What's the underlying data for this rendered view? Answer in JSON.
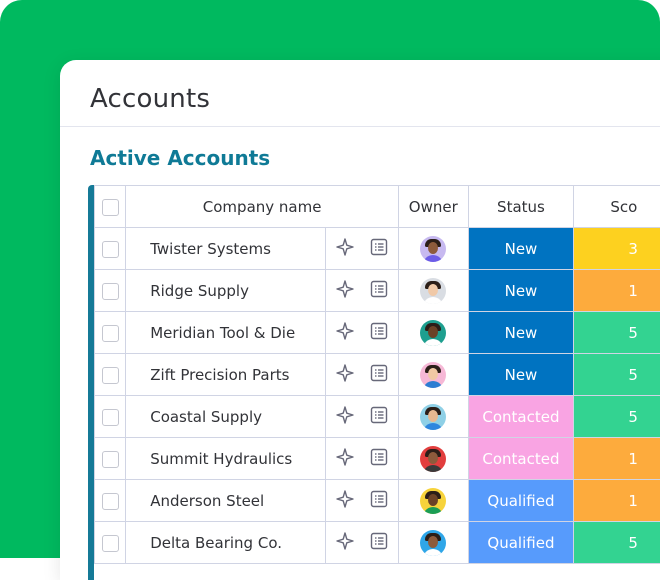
{
  "page": {
    "title": "Accounts"
  },
  "group": {
    "title": "Active Accounts",
    "color": "#157a97"
  },
  "columns": {
    "company": "Company name",
    "owner": "Owner",
    "status": "Status",
    "score": "Sco"
  },
  "rows": [
    {
      "company": "Twister Systems",
      "status": "New",
      "status_color": "#0073c1",
      "score": "3",
      "score_color": "#fdd11f",
      "avatar_bg": "#c7b9f0",
      "avatar_skin": "#8d5b3c",
      "avatar_shirt": "#6c5ce7"
    },
    {
      "company": "Ridge Supply",
      "status": "New",
      "status_color": "#0073c1",
      "score": "1",
      "score_color": "#fdab3d",
      "avatar_bg": "#d9dde3",
      "avatar_skin": "#f0c9a8",
      "avatar_shirt": "#ffffff"
    },
    {
      "company": "Meridian Tool & Die",
      "status": "New",
      "status_color": "#0073c1",
      "score": "5",
      "score_color": "#33d391",
      "avatar_bg": "#1e9f8f",
      "avatar_skin": "#6b4226",
      "avatar_shirt": "#ffffff"
    },
    {
      "company": "Zift Precision Parts",
      "status": "New",
      "status_color": "#0073c1",
      "score": "5",
      "score_color": "#33d391",
      "avatar_bg": "#f6b8d6",
      "avatar_skin": "#f1c8a4",
      "avatar_shirt": "#2d7dd2"
    },
    {
      "company": "Coastal Supply",
      "status": "Contacted",
      "status_color": "#f9a4e3",
      "score": "5",
      "score_color": "#33d391",
      "avatar_bg": "#8fd0e6",
      "avatar_skin": "#e8b890",
      "avatar_shirt": "#2e86de"
    },
    {
      "company": "Summit Hydraulics",
      "status": "Contacted",
      "status_color": "#f9a4e3",
      "score": "1",
      "score_color": "#fdab3d",
      "avatar_bg": "#e23e3e",
      "avatar_skin": "#8d5b3c",
      "avatar_shirt": "#3a3a3a"
    },
    {
      "company": "Anderson Steel",
      "status": "Qualified",
      "status_color": "#579bfc",
      "score": "1",
      "score_color": "#fdab3d",
      "avatar_bg": "#f7d33b",
      "avatar_skin": "#6b4226",
      "avatar_shirt": "#1b9e55"
    },
    {
      "company": "Delta Bearing Co.",
      "status": "Qualified",
      "status_color": "#579bfc",
      "score": "5",
      "score_color": "#33d391",
      "avatar_bg": "#2fa6e8",
      "avatar_skin": "#8d5b3c",
      "avatar_shirt": "#ffffff"
    }
  ],
  "icons": {
    "ai": "sparkle-icon",
    "details": "item-card-icon"
  },
  "colors": {
    "background": "#00b95f",
    "title": "#323338",
    "group_title": "#0f7a96",
    "border": "#d0d4e4"
  }
}
